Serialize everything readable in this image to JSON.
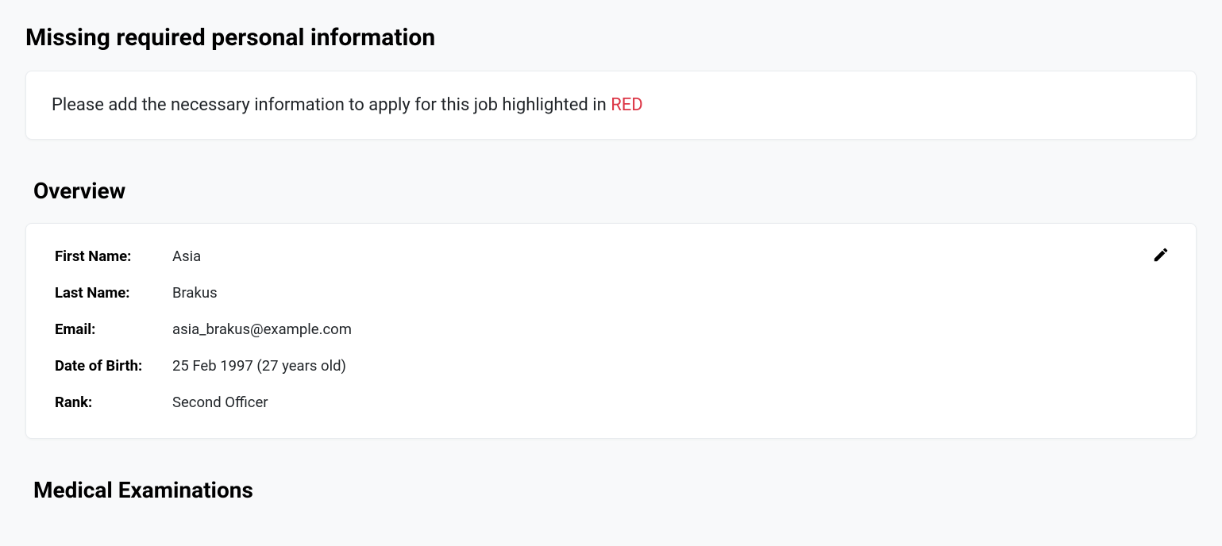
{
  "page": {
    "title": "Missing required personal information"
  },
  "alert": {
    "prefix": "Please add the necessary information to apply for this job highlighted in ",
    "highlight": "RED"
  },
  "overview": {
    "title": "Overview",
    "fields": {
      "first_name_label": "First Name:",
      "first_name_value": "Asia",
      "last_name_label": "Last Name:",
      "last_name_value": "Brakus",
      "email_label": "Email:",
      "email_value": "asia_brakus@example.com",
      "dob_label": "Date of Birth:",
      "dob_value": "25 Feb 1997 (27 years old)",
      "rank_label": "Rank:",
      "rank_value": "Second Officer"
    }
  },
  "medical": {
    "title": "Medical Examinations"
  }
}
